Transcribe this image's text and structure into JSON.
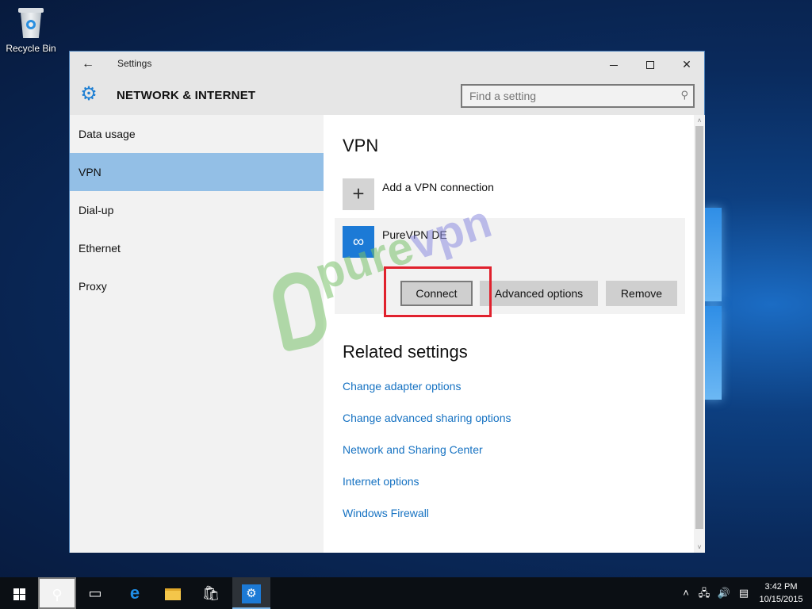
{
  "desktop": {
    "icons": [
      {
        "label": "Recycle Bin",
        "icon": "recycle-bin-icon"
      }
    ]
  },
  "window": {
    "title": "Settings",
    "back_icon": "←",
    "controls": {
      "minimize": "minimize",
      "maximize": "maximize",
      "close": "✕"
    }
  },
  "header": {
    "icon": "⚙",
    "title": "NETWORK & INTERNET",
    "search": {
      "placeholder": "Find a setting",
      "value": "",
      "icon": "⚲"
    }
  },
  "sidebar": {
    "items": [
      {
        "label": "Data usage",
        "active": false
      },
      {
        "label": "VPN",
        "active": true
      },
      {
        "label": "Dial-up",
        "active": false
      },
      {
        "label": "Ethernet",
        "active": false
      },
      {
        "label": "Proxy",
        "active": false
      }
    ]
  },
  "main": {
    "title": "VPN",
    "add_connection": {
      "icon": "+",
      "label": "Add a VPN connection"
    },
    "connections": [
      {
        "name": "PureVPN DE",
        "icon": "∞",
        "buttons": {
          "connect": "Connect",
          "advanced": "Advanced options",
          "remove": "Remove"
        },
        "highlighted_button": "Connect"
      }
    ],
    "watermark": {
      "part1": "pure",
      "part2": "vpn"
    },
    "related_title": "Related settings",
    "related_links": [
      "Change adapter options",
      "Change advanced sharing options",
      "Network and Sharing Center",
      "Internet options",
      "Windows Firewall"
    ]
  },
  "scrollbar": {
    "up": "˄",
    "down": "˅"
  },
  "taskbar": {
    "search_icon": "⚲",
    "task_view_icon": "▭",
    "edge_icon": "e",
    "store_icon": "🛍",
    "settings_icon": "⚙",
    "tray": {
      "chevron": "˄",
      "network": "🖧",
      "volume": "🔊",
      "notifications": "▤"
    },
    "time": "3:42 PM",
    "date": "10/15/2015"
  },
  "colors": {
    "accent": "#1c7ad6",
    "selected_nav": "#93bfe6",
    "link": "#1672c2",
    "highlight_box": "#e0212d"
  }
}
